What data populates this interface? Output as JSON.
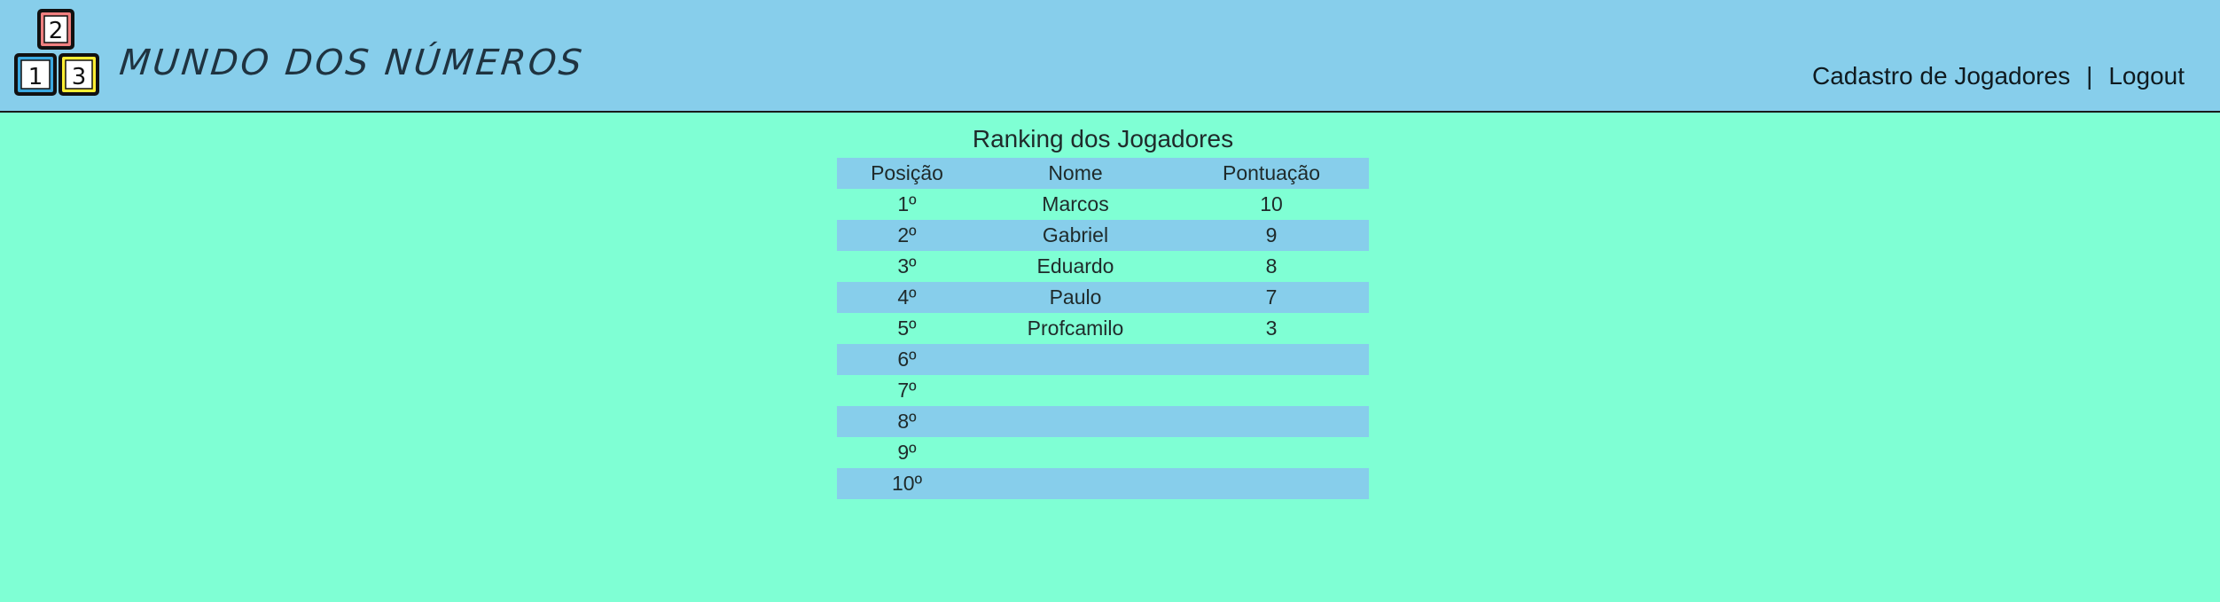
{
  "header": {
    "brand": "MUNDO DOS NÚMEROS",
    "logo": {
      "blocks": [
        {
          "digit": "2",
          "color": "#f08080"
        },
        {
          "digit": "1",
          "color": "#3ba9e0"
        },
        {
          "digit": "3",
          "color": "#ffee33"
        }
      ]
    },
    "nav": {
      "cadastro": "Cadastro de Jogadores",
      "separator": "|",
      "logout": "Logout"
    }
  },
  "ranking": {
    "title": "Ranking dos Jogadores",
    "columns": [
      "Posição",
      "Nome",
      "Pontuação"
    ],
    "rows": [
      {
        "pos": "1º",
        "nome": "Marcos",
        "pts": "10"
      },
      {
        "pos": "2º",
        "nome": "Gabriel",
        "pts": "9"
      },
      {
        "pos": "3º",
        "nome": "Eduardo",
        "pts": "8"
      },
      {
        "pos": "4º",
        "nome": "Paulo",
        "pts": "7"
      },
      {
        "pos": "5º",
        "nome": "Profcamilo",
        "pts": "3"
      },
      {
        "pos": "6º",
        "nome": "",
        "pts": ""
      },
      {
        "pos": "7º",
        "nome": "",
        "pts": ""
      },
      {
        "pos": "8º",
        "nome": "",
        "pts": ""
      },
      {
        "pos": "9º",
        "nome": "",
        "pts": ""
      },
      {
        "pos": "10º",
        "nome": "",
        "pts": ""
      }
    ]
  },
  "colors": {
    "header_bg": "#87ceeb",
    "page_bg": "#7fffd4",
    "row_stripe": "#87ceeb"
  }
}
